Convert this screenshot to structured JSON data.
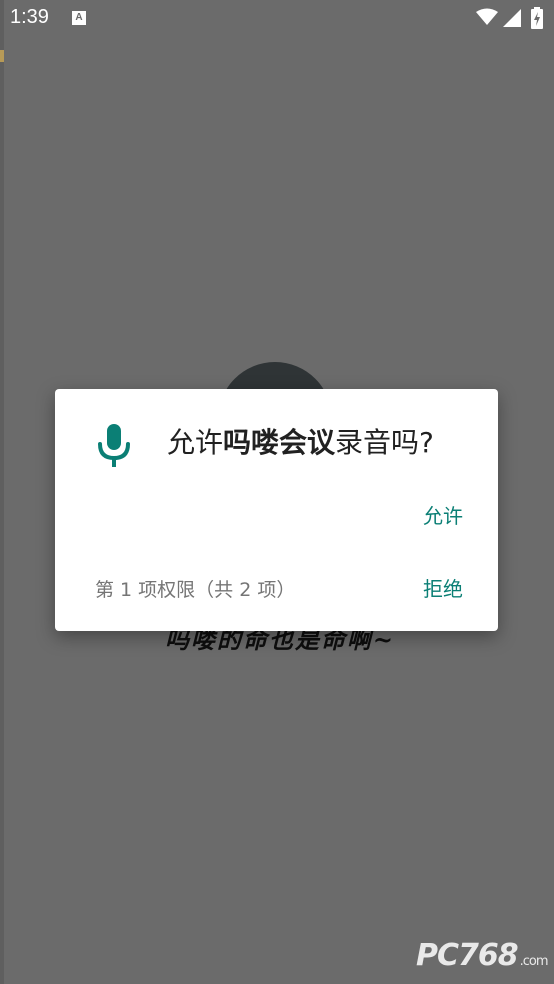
{
  "status_bar": {
    "time": "1:39",
    "notification_icon": "A",
    "icons": [
      "wifi-icon",
      "signal-icon",
      "battery-charging-icon"
    ]
  },
  "background_app": {
    "slogan": "吗喽的命也是命啊~"
  },
  "dialog": {
    "title_prefix": "允许",
    "app_name": "吗喽会议",
    "title_suffix": "录音吗?",
    "icon": "microphone-icon",
    "accent_color": "#0b7f75",
    "allow_label": "允许",
    "deny_label": "拒绝",
    "counter": "第 1 项权限（共 2 项）"
  },
  "watermark": {
    "text": "PC768",
    "suffix": ".com"
  }
}
